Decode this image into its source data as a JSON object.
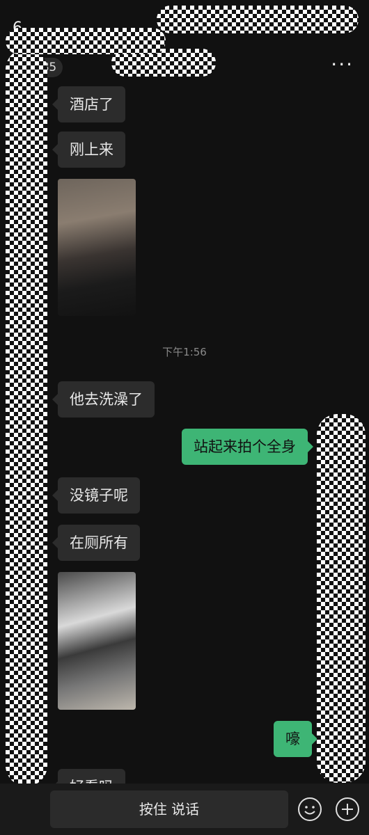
{
  "status_bar": {
    "time": "6",
    "icons": [
      "signal-icon",
      "wifi-icon",
      "battery-icon"
    ]
  },
  "header": {
    "unread_count": "185",
    "more_label": "···"
  },
  "messages": [
    {
      "side": "left",
      "type": "text",
      "text": "酒店了"
    },
    {
      "side": "left",
      "type": "text",
      "text": "刚上来"
    },
    {
      "side": "left",
      "type": "image"
    },
    {
      "type": "timestamp",
      "text": "下午1:56"
    },
    {
      "side": "left",
      "type": "text",
      "text": "他去洗澡了"
    },
    {
      "side": "right",
      "type": "text",
      "text": "站起来拍个全身"
    },
    {
      "side": "left",
      "type": "text",
      "text": "没镜子呢"
    },
    {
      "side": "left",
      "type": "text",
      "text": "在厕所有"
    },
    {
      "side": "left",
      "type": "image"
    },
    {
      "side": "right",
      "type": "text",
      "text": "嚎"
    },
    {
      "side": "left",
      "type": "text",
      "text": "好看吗"
    }
  ],
  "input_bar": {
    "voice_label": "按住 说话"
  },
  "colors": {
    "background": "#111111",
    "bubble_left": "#2c2c2c",
    "bubble_right": "#3eb575"
  }
}
